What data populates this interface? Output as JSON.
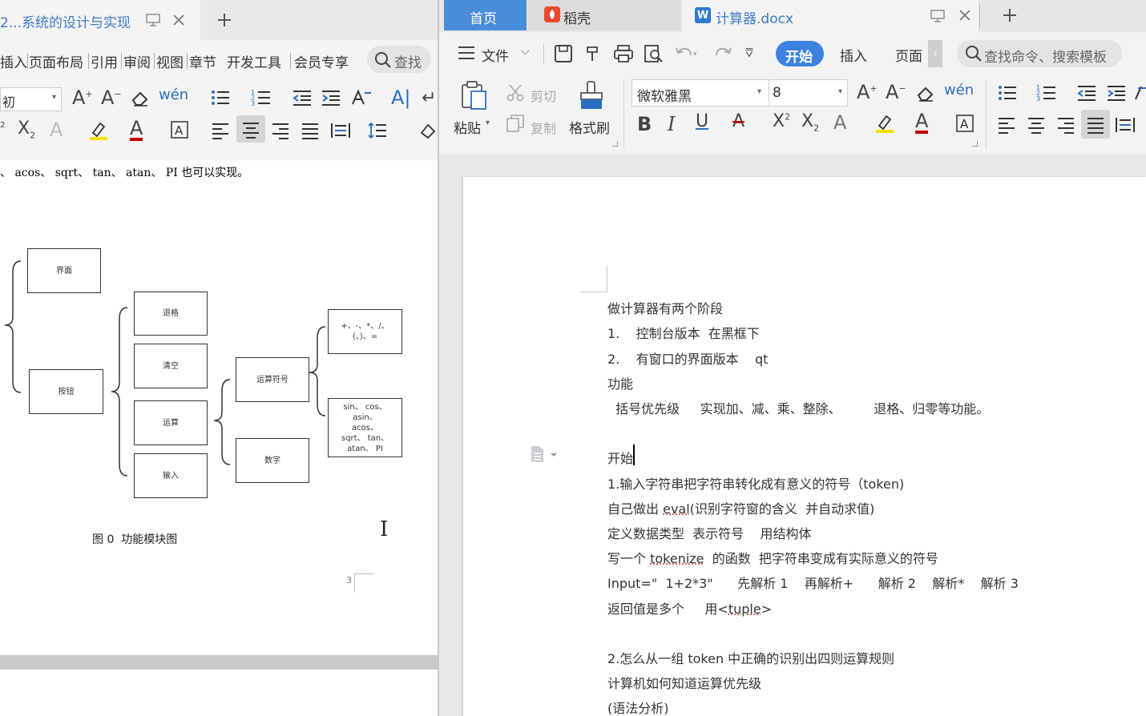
{
  "left": {
    "tab_title": "2...系统的设计与实现",
    "menu": [
      "插入",
      "页面布局",
      "引用",
      "审阅",
      "视图",
      "章节",
      "开发工具",
      "会员专享"
    ],
    "search_label": "查找",
    "font_size": "初",
    "top_text": "、 acos、 sqrt、 tan、 atan、 PI 也可以实现。",
    "diagram": {
      "jiemian": "界面",
      "anniu": "按钮",
      "tuige": "退格",
      "qingkong": "清空",
      "yunsuan": "运算",
      "shuru": "输入",
      "yunsuanfuhao": "运算符号",
      "shuzi": "数字",
      "ops_line1": "+、-、*、/、",
      "ops_line2": "(、)、=",
      "fn_line1": "sin、 cos、",
      "fn_line2": "asin、",
      "fn_line3": "acos、",
      "fn_line4": "sqrt、 tan、",
      "fn_line5": "atan、 PI"
    },
    "caption": "图 0  功能模块图",
    "page_number": "3"
  },
  "right": {
    "tabs": {
      "home": "首页",
      "daoke": "稻壳",
      "doc": "计算器.docx"
    },
    "menu": {
      "file": "文件",
      "start": "开始",
      "insert": "插入",
      "page": "页面",
      "search_placeholder": "查找命令、搜索模板"
    },
    "ribbon": {
      "paste": "粘贴",
      "cut": "剪切",
      "copy": "复制",
      "format_painter": "格式刷",
      "font_name": "微软雅黑",
      "font_size": "8"
    },
    "doc_lines": [
      "做计算器有两个阶段",
      "1.    控制台版本  在黑框下",
      "2.    有窗口的界面版本    qt",
      "功能",
      "  括号优先级     实现加、减、乘、整除、        退格、归零等功能。",
      "",
      "开始",
      "1.输入字符串把字符串转化成有意义的符号（token)",
      "",
      "",
      "定义数据类型  表示符号    用结构体",
      "",
      "Input=\"  1+2*3\"      先解析 1    再解析+      解析 2    解析*    解析 3",
      "",
      "",
      "2.怎么从一组 token 中正确的识别出四则运算规则",
      "计算机如何知道运算优先级",
      "(语法分析)"
    ],
    "line7_a": "自己做出 ",
    "line7_b": "eval",
    "line7_c": "(识别字符窗的含义  并自动求值)",
    "line9_a": "写一个 ",
    "line9_b": "tokenize",
    "line9_c": "  的函数  把字符串变成有实际意义的符号",
    "line13_a": "返回值是多个     用<",
    "line13_b": "tuple",
    "line13_c": ">"
  },
  "colors": {
    "wps_blue": "#2b7bd3",
    "tab_active_blue": "#4a8cd8",
    "start_pill": "#3d82e0",
    "left_tab_text": "#3a7bc8"
  }
}
